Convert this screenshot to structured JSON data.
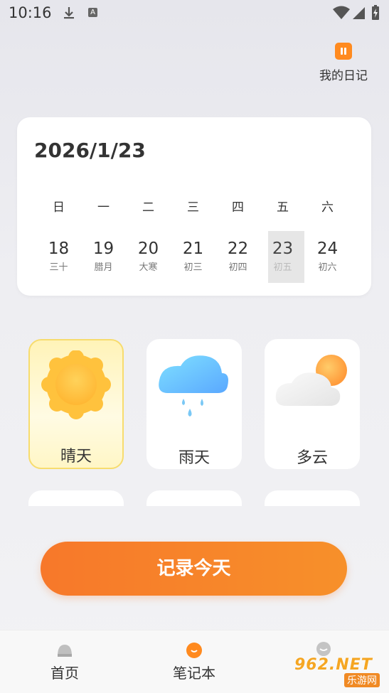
{
  "status_bar": {
    "time": "10:16",
    "a_badge": "A"
  },
  "header": {
    "diary_label": "我的日记",
    "diary_icon": "pause-icon",
    "accent": "#ff8a1f"
  },
  "calendar": {
    "date": "2026/1/23",
    "weekdays": [
      "日",
      "一",
      "二",
      "三",
      "四",
      "五",
      "六"
    ],
    "days": [
      {
        "num": "18",
        "lunar": "三十"
      },
      {
        "num": "19",
        "lunar": "腊月"
      },
      {
        "num": "20",
        "lunar": "大寒"
      },
      {
        "num": "21",
        "lunar": "初三"
      },
      {
        "num": "22",
        "lunar": "初四"
      },
      {
        "num": "23",
        "lunar": "初五"
      },
      {
        "num": "24",
        "lunar": "初六"
      }
    ],
    "selected": "23"
  },
  "weather": [
    {
      "label": "晴天",
      "icon": "sun-icon"
    },
    {
      "label": "雨天",
      "icon": "rain-cloud-icon"
    },
    {
      "label": "多云",
      "icon": "cloudy-icon"
    }
  ],
  "record_button": {
    "label": "记录今天",
    "color": "#f7782a"
  },
  "nav": [
    {
      "label": "首页",
      "icon": "home-icon"
    },
    {
      "label": "笔记本",
      "icon": "notebook-icon"
    },
    {
      "label": "",
      "icon": "profile-icon"
    }
  ],
  "watermark": {
    "text": "962.NET",
    "subtext": "乐游网"
  }
}
